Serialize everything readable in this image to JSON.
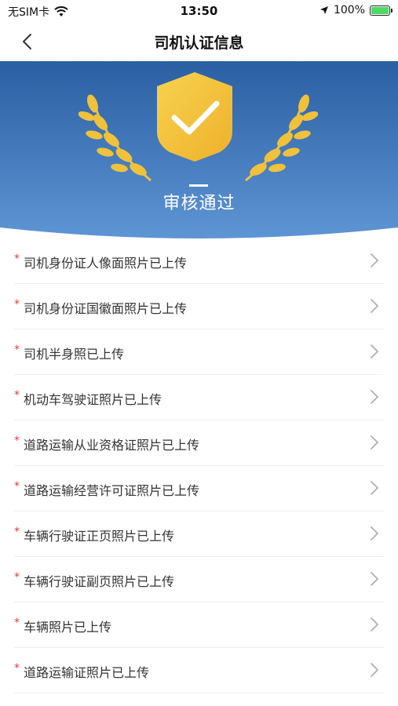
{
  "status_bar": {
    "carrier": "无SIM卡",
    "time": "13:50",
    "battery": "100%"
  },
  "nav": {
    "title": "司机认证信息"
  },
  "hero": {
    "status_text": "审核通过",
    "colors": {
      "background_top": "#2a63a6",
      "background_bottom": "#5b92d2",
      "badge_gold": "#f3c33d",
      "laurel_gold": "#f0c13a"
    }
  },
  "items": [
    {
      "label": "司机身份证人像面照片已上传"
    },
    {
      "label": "司机身份证国徽面照片已上传"
    },
    {
      "label": "司机半身照已上传"
    },
    {
      "label": "机动车驾驶证照片已上传"
    },
    {
      "label": "道路运输从业资格证照片已上传"
    },
    {
      "label": "道路运输经营许可证照片已上传"
    },
    {
      "label": "车辆行驶证正页照片已上传"
    },
    {
      "label": "车辆行驶证副页照片已上传"
    },
    {
      "label": "车辆照片已上传"
    },
    {
      "label": "道路运输证照片已上传"
    }
  ],
  "required_marker": "*",
  "icons": {
    "back": "chevron-left-icon",
    "wifi": "wifi-icon",
    "location": "location-arrow-icon",
    "battery": "battery-charging-icon",
    "badge": "shield-check-icon",
    "row_arrow": "chevron-right-icon"
  }
}
